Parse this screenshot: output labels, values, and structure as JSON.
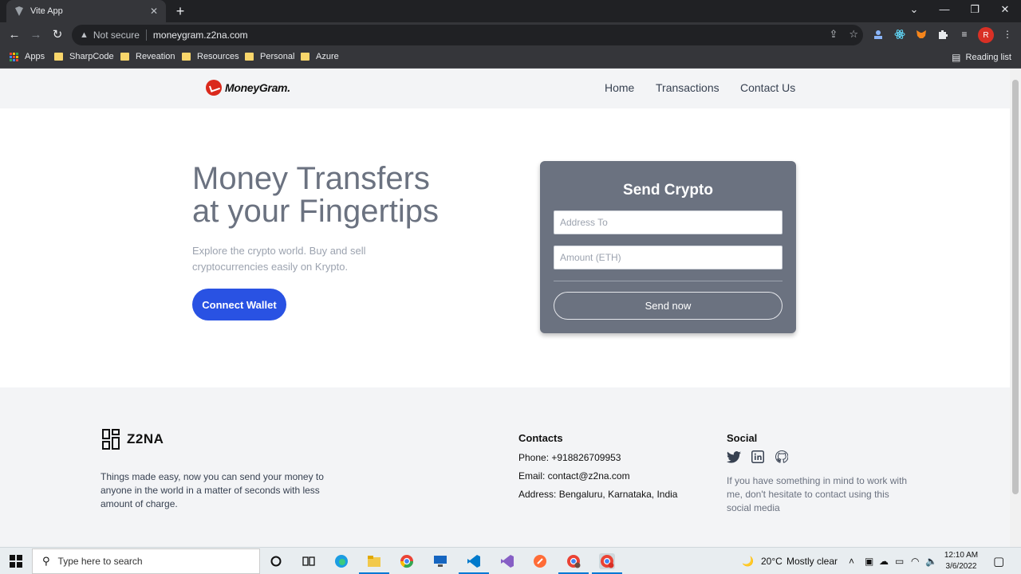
{
  "browser": {
    "tab_title": "Vite App",
    "tab_close": "✕",
    "new_tab": "+",
    "security_label": "Not secure",
    "url": "moneygram.z2na.com",
    "profile_initial": "R",
    "window_controls": [
      "⌄",
      "—",
      "❐",
      "✕"
    ]
  },
  "bookmarks": {
    "items": [
      "Apps",
      "SharpCode",
      "Reveation",
      "Resources",
      "Personal",
      "Azure"
    ],
    "reading_list": "Reading list"
  },
  "site": {
    "logo_text": "MoneyGram.",
    "nav": [
      "Home",
      "Transactions",
      "Contact Us"
    ]
  },
  "hero": {
    "title_line1": "Money Transfers",
    "title_line2": "at your Fingertips",
    "subtitle": "Explore the crypto world. Buy and sell cryptocurrencies easily on Krypto.",
    "connect_label": "Connect Wallet"
  },
  "send_card": {
    "title": "Send Crypto",
    "address_placeholder": "Address To",
    "amount_placeholder": "Amount (ETH)",
    "address_value": "",
    "amount_value": "",
    "send_label": "Send now"
  },
  "footer": {
    "brand": "Z2NA",
    "description": "Things made easy, now you can send your money to anyone in the world in a matter of seconds with less amount of charge.",
    "contacts_title": "Contacts",
    "phone": "Phone: +918826709953",
    "email": "Email: contact@z2na.com",
    "address": "Address: Bengaluru, Karnataka, India",
    "social_title": "Social",
    "social_icons": [
      "twitter-icon",
      "linkedin-icon",
      "github-icon"
    ],
    "social_desc": "If you have something in mind to work with me, don't hesitate to contact using this social media"
  },
  "taskbar": {
    "search_placeholder": "Type here to search",
    "weather_temp": "20°C",
    "weather_desc": "Mostly clear",
    "time": "12:10 AM",
    "date": "3/6/2022"
  },
  "colors": {
    "accent": "#2952e3",
    "card_bg": "#6b7280",
    "brand_red": "#da291c"
  }
}
